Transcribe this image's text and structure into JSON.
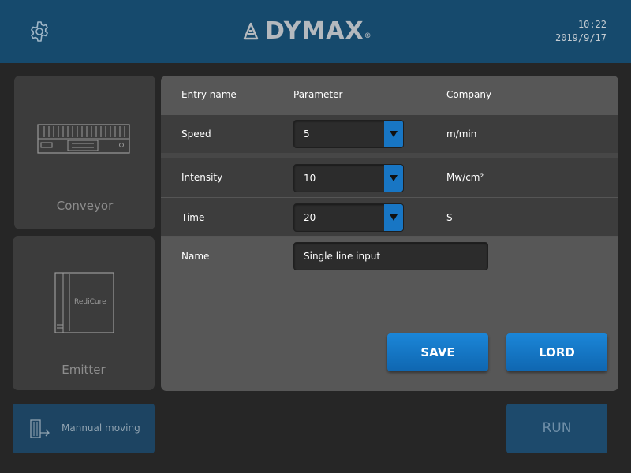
{
  "header": {
    "brand": "DYMAX",
    "brand_mark": "®",
    "time": "10:22",
    "date": "2019/9/17",
    "settings_icon": "gear-icon"
  },
  "sidebar": {
    "conveyor": {
      "label": "Conveyor",
      "icon": "conveyor-icon"
    },
    "emitter": {
      "label": "Emitter",
      "icon": "emitter-icon",
      "device_text": "RediCure"
    }
  },
  "table": {
    "headers": {
      "entry": "Entry name",
      "parameter": "Parameter",
      "unit": "Company"
    },
    "rows": [
      {
        "name": "Speed",
        "value": "5",
        "unit": "m/min"
      },
      {
        "name": "Intensity",
        "value": "10",
        "unit": "Mw/cm²"
      },
      {
        "name": "Time",
        "value": "20",
        "unit": "S"
      }
    ],
    "name_row": {
      "label": "Name",
      "placeholder": "Single line input"
    }
  },
  "actions": {
    "save": "SAVE",
    "lord": "LORD",
    "manual": "Mannual moving",
    "run": "RUN"
  },
  "colors": {
    "header_bg": "#164a6d",
    "accent": "#1876c4",
    "panel_bg": "#575757"
  }
}
